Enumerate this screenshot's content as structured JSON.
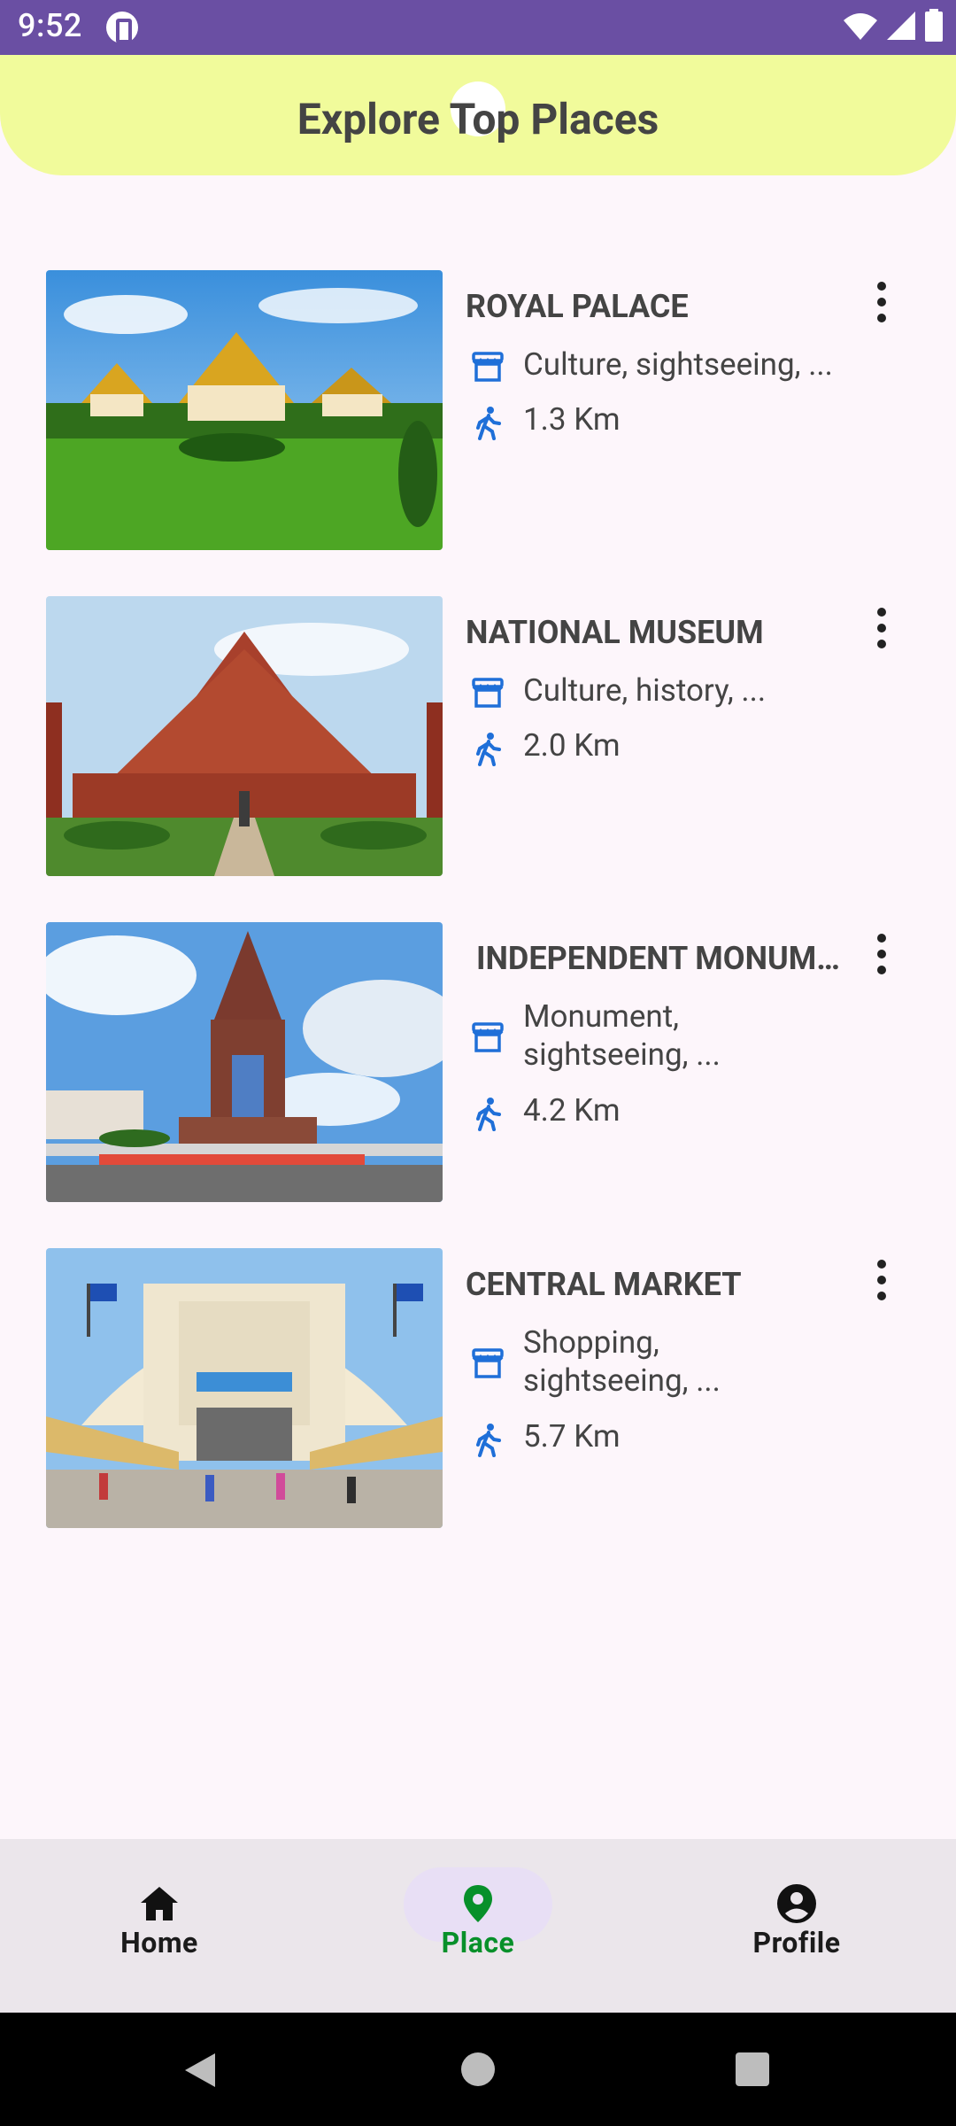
{
  "status_bar": {
    "time": "9:52",
    "icons": [
      "app-badge-icon",
      "wifi-icon",
      "signal-icon",
      "battery-icon"
    ]
  },
  "header": {
    "title": "Explore Top Places",
    "background": "#f1fb9b"
  },
  "places": [
    {
      "name": "ROYAL PALACE",
      "tags": "Culture, sightseeing, ...",
      "distance": "1.3 Km",
      "image": "royal-palace-photo"
    },
    {
      "name": "NATIONAL MUSEUM",
      "tags": "Culture, history, ...",
      "distance": "2.0 Km",
      "image": "national-museum-photo"
    },
    {
      "name": "INDEPENDENT MONUMENT",
      "tags": "Monument, sightseeing, ...",
      "distance": "4.2 Km",
      "image": "independence-monument-photo"
    },
    {
      "name": "CENTRAL MARKET",
      "tags": "Shopping, sightseeing, ...",
      "distance": "5.7 Km",
      "image": "central-market-photo"
    }
  ],
  "bottom_nav": {
    "items": [
      {
        "label": "Home",
        "icon": "home-icon"
      },
      {
        "label": "Place",
        "icon": "location-pin-icon",
        "active": true
      },
      {
        "label": "Profile",
        "icon": "account-circle-icon"
      }
    ],
    "active_color": "#07902a"
  },
  "system_nav": [
    "back-button",
    "home-button",
    "recents-button"
  ]
}
